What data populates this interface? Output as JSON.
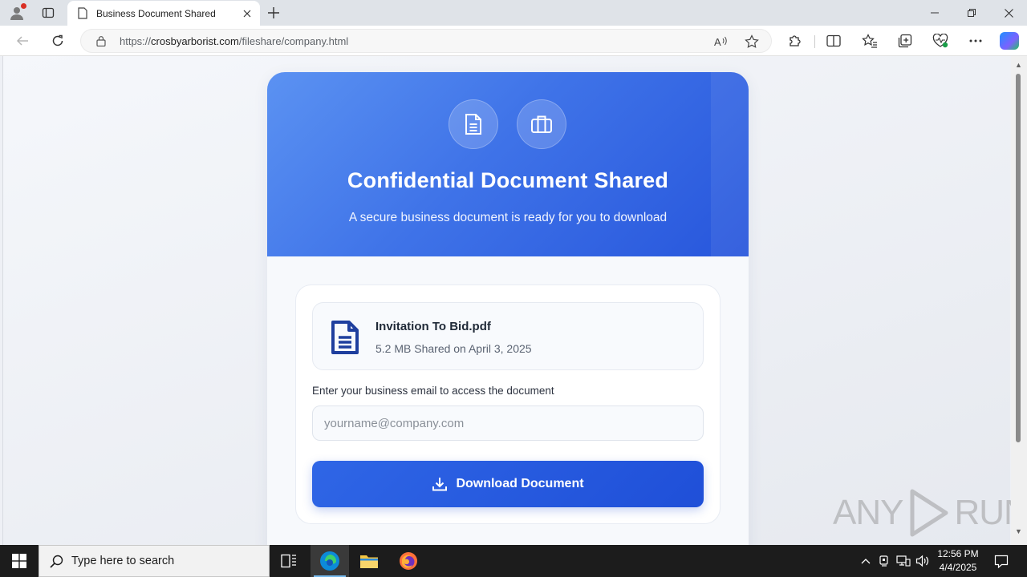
{
  "browser": {
    "tab_title": "Business Document Shared",
    "url_prefix": "https://",
    "url_host": "crosbyarborist.com",
    "url_path": "/fileshare/company.html",
    "read_aloud_label": "Ȃ"
  },
  "page": {
    "title": "Confidential Document Shared",
    "subtitle": "A secure business document is ready for you to download",
    "file": {
      "name": "Invitation To Bid.pdf",
      "meta": "5.2 MB Shared on April 3, 2025"
    },
    "email_label": "Enter your business email to access the document",
    "email_placeholder": "yourname@company.com",
    "email_value": "",
    "download_label": "Download Document",
    "header_icons": [
      "document-icon",
      "briefcase-icon"
    ]
  },
  "watermark": {
    "left": "ANY",
    "right": "RUN"
  },
  "taskbar": {
    "search_placeholder": "Type here to search",
    "time": "12:56 PM",
    "date": "4/4/2025"
  },
  "colors": {
    "header_start": "#5b92f2",
    "header_end": "#2756dc",
    "button": "#2456dd",
    "file_icon": "#1f3f9e"
  }
}
